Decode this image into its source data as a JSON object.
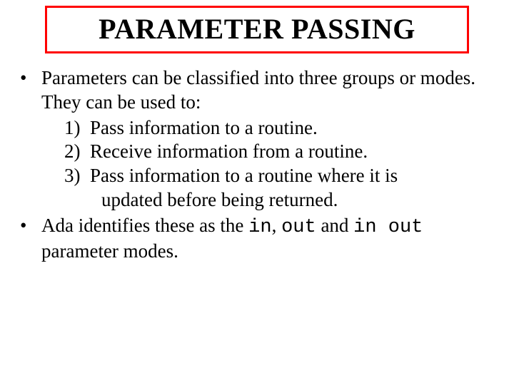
{
  "title": "PARAMETER PASSING",
  "bullets": [
    {
      "lead": "•",
      "text": "Parameters can be classified into three groups or modes. They can be used to:"
    },
    {
      "lead": "•",
      "before": "Ada identifies these as the ",
      "kw1": "in",
      "sep1": ", ",
      "kw2": "out",
      "mid": " and ",
      "kw3": "in out",
      "after": " parameter modes."
    }
  ],
  "numbered": [
    {
      "n": "1)",
      "text": "Pass information to a routine."
    },
    {
      "n": "2)",
      "text": "Receive information from a routine."
    },
    {
      "n": "3)",
      "text": "Pass information to a routine where it is",
      "cont": "updated before being returned."
    }
  ]
}
